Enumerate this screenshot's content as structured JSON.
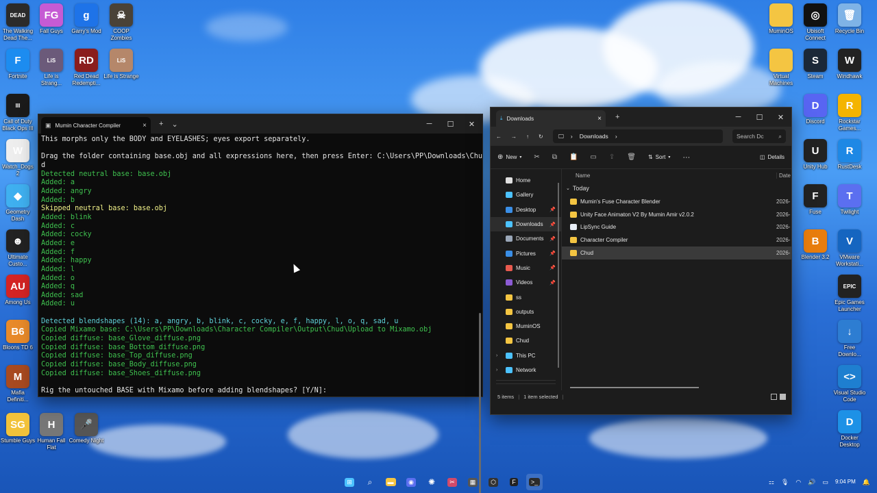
{
  "desktop_left": [
    {
      "label": "The Walking Dead The...",
      "color": "#2b2b2b",
      "glyph": "DEAD"
    },
    {
      "label": "Fall Guys",
      "color": "#c65bd4",
      "glyph": "FG"
    },
    {
      "label": "Garry's Mod",
      "color": "#1e73e8",
      "glyph": "g"
    },
    {
      "label": "COOP Zombies",
      "color": "#4a4237",
      "glyph": "☠"
    },
    {
      "label": "Fortnite",
      "color": "#1c8cf0",
      "glyph": "F"
    },
    {
      "label": "Life is Strang...",
      "color": "#6b5a7a",
      "glyph": "LiS"
    },
    {
      "label": "Red Dead Redempti...",
      "color": "#8a1d1d",
      "glyph": "RD"
    },
    {
      "label": "Life is Strange",
      "color": "#b5876a",
      "glyph": "LiS"
    },
    {
      "label": "Call of Duty Black Ops III",
      "color": "#1a1a1a",
      "glyph": "III"
    },
    {
      "label": "Watch_Dogs 2",
      "color": "#eeeeee",
      "glyph": "W"
    },
    {
      "label": "Geometry Dash",
      "color": "#3fb0f0",
      "glyph": "◆"
    },
    {
      "label": "Ultimate Custo...",
      "color": "#222",
      "glyph": "☻"
    },
    {
      "label": "Among Us",
      "color": "#d42424",
      "glyph": "AU"
    },
    {
      "label": "Bloons TD 6",
      "color": "#e88a2a",
      "glyph": "B6"
    },
    {
      "label": "Mafia Definiti...",
      "color": "#a84a20",
      "glyph": "M"
    },
    {
      "label": "Stumble Guys",
      "color": "#f2c23a",
      "glyph": "SG"
    },
    {
      "label": "Human Fall Flat",
      "color": "#777",
      "glyph": "H"
    },
    {
      "label": "Comedy Night",
      "color": "#555",
      "glyph": "🎤"
    }
  ],
  "desktop_right": [
    {
      "label": "MuminOS",
      "color": "#f4c542",
      "glyph": ""
    },
    {
      "label": "Ubisoft Connect",
      "color": "#111",
      "glyph": "◎"
    },
    {
      "label": "Recycle Bin",
      "color": "#7fb3e6",
      "glyph": "🗑"
    },
    {
      "label": "Virtual Machines",
      "color": "#f4c542",
      "glyph": ""
    },
    {
      "label": "Steam",
      "color": "#1b2838",
      "glyph": "S"
    },
    {
      "label": "Windhawk",
      "color": "#222",
      "glyph": "W"
    },
    {
      "label": "Discord",
      "color": "#5865f2",
      "glyph": "D"
    },
    {
      "label": "Rockstar Games...",
      "color": "#f4b400",
      "glyph": "R"
    },
    {
      "label": "Unity Hub",
      "color": "#222",
      "glyph": "U"
    },
    {
      "label": "RustDesk",
      "color": "#1e88e5",
      "glyph": "R"
    },
    {
      "label": "Fuse",
      "color": "#222",
      "glyph": "F"
    },
    {
      "label": "Twilight",
      "color": "#5b6ff0",
      "glyph": "T"
    },
    {
      "label": "Blender 3.2",
      "color": "#e87d0d",
      "glyph": "B"
    },
    {
      "label": "VMware Workstati...",
      "color": "#1565c0",
      "glyph": "V"
    },
    {
      "label": "Epic Games Launcher",
      "color": "#222",
      "glyph": "EPIC"
    },
    {
      "label": "Free Downlo...",
      "color": "#2d7dd2",
      "glyph": "↓"
    },
    {
      "label": "Visual Studio Code",
      "color": "#1e7fd0",
      "glyph": "<>"
    },
    {
      "label": "Docker Desktop",
      "color": "#1d91e6",
      "glyph": "D"
    }
  ],
  "terminal": {
    "tab_title": "Mumin Character Compiler",
    "new_tab": "+",
    "dropdown": "⌄",
    "lines": [
      {
        "t": "This morphs only the BODY and EYELASHES; eyes export separately.",
        "c": "w"
      },
      {
        "t": "",
        "c": "w"
      },
      {
        "t": "Drag the folder containing base.obj and all expressions here, then press Enter: C:\\Users\\PP\\Downloads\\Chu",
        "c": "w"
      },
      {
        "t": "d",
        "c": "w"
      },
      {
        "t": "Detected neutral base: base.obj",
        "c": "g"
      },
      {
        "t": "Added: a",
        "c": "g"
      },
      {
        "t": "Added: angry",
        "c": "g"
      },
      {
        "t": "Added: b",
        "c": "g"
      },
      {
        "t": "Skipped neutral base: base.obj",
        "c": "y"
      },
      {
        "t": "Added: blink",
        "c": "g"
      },
      {
        "t": "Added: c",
        "c": "g"
      },
      {
        "t": "Added: cocky",
        "c": "g"
      },
      {
        "t": "Added: e",
        "c": "g"
      },
      {
        "t": "Added: f",
        "c": "g"
      },
      {
        "t": "Added: happy",
        "c": "g"
      },
      {
        "t": "Added: l",
        "c": "g"
      },
      {
        "t": "Added: o",
        "c": "g"
      },
      {
        "t": "Added: q",
        "c": "g"
      },
      {
        "t": "Added: sad",
        "c": "g"
      },
      {
        "t": "Added: u",
        "c": "g"
      },
      {
        "t": "",
        "c": "w"
      },
      {
        "t": "Detected blendshapes (14): a, angry, b, blink, c, cocky, e, f, happy, l, o, q, sad, u",
        "c": "c"
      },
      {
        "t": "Copied Mixamo base: C:\\Users\\PP\\Downloads\\Character Compiler\\Output\\Chud\\Upload to Mixamo.obj",
        "c": "g"
      },
      {
        "t": "Copied diffuse: base_Glove_diffuse.png",
        "c": "g"
      },
      {
        "t": "Copied diffuse: base_Bottom_diffuse.png",
        "c": "g"
      },
      {
        "t": "Copied diffuse: base_Top_diffuse.png",
        "c": "g"
      },
      {
        "t": "Copied diffuse: base_Body_diffuse.png",
        "c": "g"
      },
      {
        "t": "Copied diffuse: base_Shoes_diffuse.png",
        "c": "g"
      },
      {
        "t": "",
        "c": "w"
      },
      {
        "t": "Rig the untouched BASE with Mixamo before adding blendshapes? [Y/N]:",
        "c": "w"
      }
    ]
  },
  "explorer": {
    "tab_title": "Downloads",
    "new_tab": "+",
    "breadcrumb": "Downloads",
    "search_placeholder": "Search Dc",
    "cmd": {
      "new": "New",
      "sort": "Sort",
      "more": "···",
      "details": "Details"
    },
    "nav": [
      {
        "label": "Home",
        "icon": "home",
        "pin": false
      },
      {
        "label": "Gallery",
        "icon": "gallery",
        "pin": false
      },
      {
        "sep": true
      },
      {
        "label": "Desktop",
        "icon": "desktop",
        "pin": true
      },
      {
        "label": "Downloads",
        "icon": "downloads",
        "pin": true,
        "sel": true
      },
      {
        "label": "Documents",
        "icon": "documents",
        "pin": true
      },
      {
        "label": "Pictures",
        "icon": "pictures",
        "pin": true
      },
      {
        "label": "Music",
        "icon": "music",
        "pin": true
      },
      {
        "label": "Videos",
        "icon": "videos",
        "pin": true
      },
      {
        "label": "ss",
        "icon": "folder",
        "pin": false
      },
      {
        "label": "outputs",
        "icon": "folder",
        "pin": false
      },
      {
        "label": "MuminOS",
        "icon": "folder",
        "pin": false
      },
      {
        "label": "Chud",
        "icon": "folder",
        "pin": false
      },
      {
        "sep": true
      },
      {
        "label": "This PC",
        "icon": "pc",
        "pin": false,
        "chev": true
      },
      {
        "label": "Network",
        "icon": "network",
        "pin": false,
        "chev": true
      }
    ],
    "columns": {
      "name": "Name",
      "date": "Date"
    },
    "group": "Today",
    "files": [
      {
        "name": "Mumin's Fuse Character Blender",
        "date": "2026-",
        "icon": "folder"
      },
      {
        "name": "Unity Face Animaton V2 By Mumin Amir v2.0.2",
        "date": "2026-",
        "icon": "folder"
      },
      {
        "name": "LipSync Guide",
        "date": "2026-",
        "icon": "doc"
      },
      {
        "name": "Character Compiler",
        "date": "2026-",
        "icon": "folder"
      },
      {
        "name": "Chud",
        "date": "2026-",
        "icon": "folder",
        "sel": true
      }
    ],
    "status": {
      "items": "5 items",
      "selected": "1 item selected"
    }
  },
  "taskbar": {
    "time": "9:04 PM",
    "apps": [
      "start",
      "search",
      "file-explorer",
      "app-blue",
      "chatgpt",
      "snipping",
      "calculator",
      "unity",
      "fuse",
      "terminal"
    ]
  }
}
